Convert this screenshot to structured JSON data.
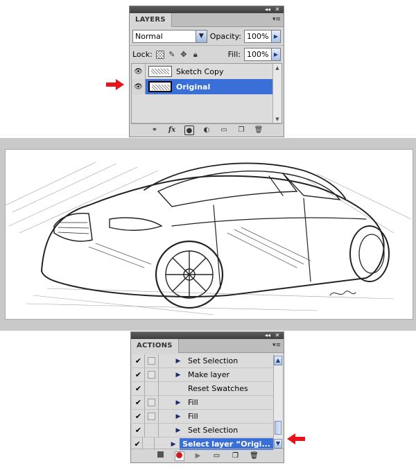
{
  "layers_panel": {
    "tab": "LAYERS",
    "blend_mode": "Normal",
    "opacity_label": "Opacity:",
    "opacity_value": "100%",
    "lock_label": "Lock:",
    "fill_label": "Fill:",
    "fill_value": "100%",
    "layers": [
      {
        "name": "Sketch Copy",
        "visible": true,
        "selected": false
      },
      {
        "name": "Original",
        "visible": true,
        "selected": true
      }
    ]
  },
  "actions_panel": {
    "tab": "ACTIONS",
    "items": [
      {
        "name": "Set Selection",
        "checked": true,
        "dialog": true,
        "has_arrow": true
      },
      {
        "name": "Make layer",
        "checked": true,
        "dialog": true,
        "has_arrow": true
      },
      {
        "name": "Reset Swatches",
        "checked": true,
        "dialog": false,
        "has_arrow": false
      },
      {
        "name": "Fill",
        "checked": true,
        "dialog": true,
        "has_arrow": true
      },
      {
        "name": "Fill",
        "checked": true,
        "dialog": true,
        "has_arrow": true
      },
      {
        "name": "Set Selection",
        "checked": true,
        "dialog": false,
        "has_arrow": true
      },
      {
        "name": "Select layer “Origi...",
        "checked": true,
        "dialog": false,
        "has_arrow": true,
        "selected": true
      }
    ]
  },
  "colors": {
    "selection": "#3a6fd8",
    "arrow": "#e8141b",
    "record": "#d11a1a"
  }
}
